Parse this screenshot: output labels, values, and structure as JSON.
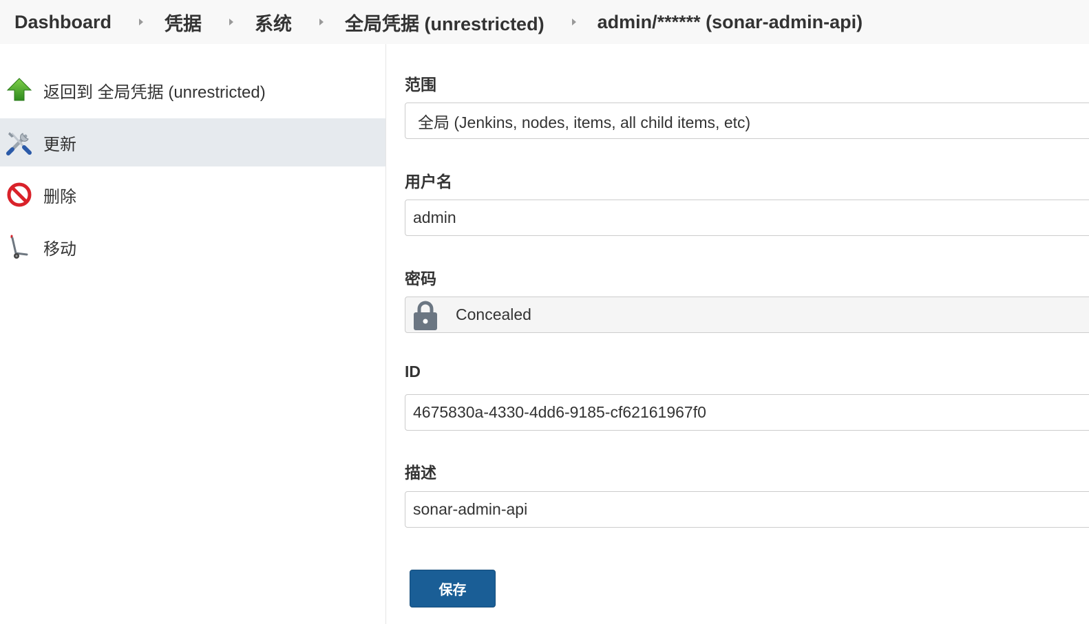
{
  "breadcrumb": [
    {
      "label": "Dashboard"
    },
    {
      "label": "凭据"
    },
    {
      "label": "系统"
    },
    {
      "label": "全局凭据 (unrestricted)"
    },
    {
      "label": "admin/****** (sonar-admin-api)"
    }
  ],
  "sidebar": {
    "items": [
      {
        "label": "返回到 全局凭据 (unrestricted)",
        "icon": "up-arrow-icon",
        "active": false
      },
      {
        "label": "更新",
        "icon": "tools-icon",
        "active": true
      },
      {
        "label": "删除",
        "icon": "no-entry-icon",
        "active": false
      },
      {
        "label": "移动",
        "icon": "hand-truck-icon",
        "active": false
      }
    ]
  },
  "form": {
    "scope": {
      "label": "范围",
      "value": "全局 (Jenkins, nodes, items, all child items, etc)"
    },
    "username": {
      "label": "用户名",
      "value": "admin"
    },
    "password": {
      "label": "密码",
      "value": "Concealed",
      "icon": "lock-icon"
    },
    "id": {
      "label": "ID",
      "value": "4675830a-4330-4dd6-9185-cf62161967f0"
    },
    "description": {
      "label": "描述",
      "value": "sonar-admin-api"
    },
    "save_label": "保存"
  },
  "colors": {
    "breadcrumb_bg": "#f8f8f8",
    "sidebar_active_bg": "#e6eaee",
    "save_button": "#1a5e96",
    "lock_icon": "#6b7682"
  }
}
